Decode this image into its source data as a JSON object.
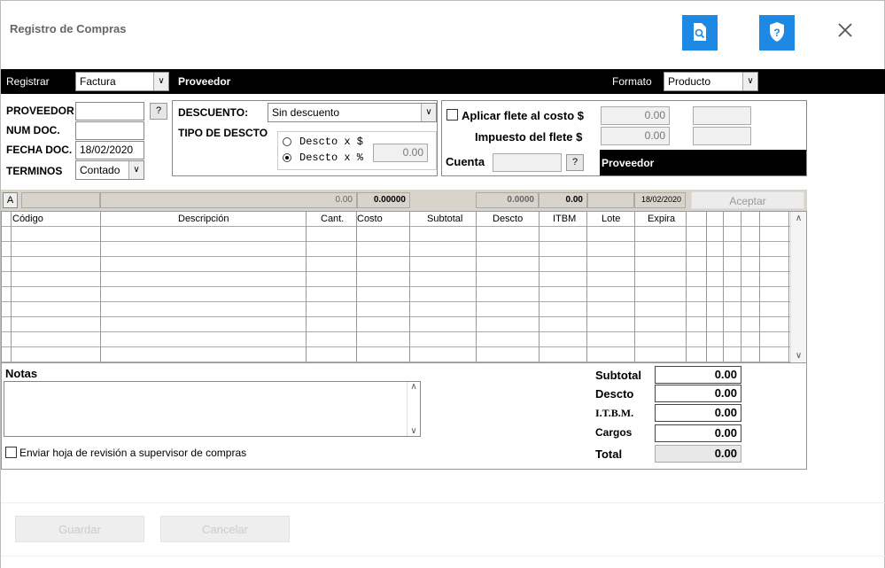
{
  "window": {
    "title": "Registro de Compras"
  },
  "icons": {
    "preview": "document-search-icon",
    "security": "shield-question-icon",
    "close": "close-icon"
  },
  "topbar": {
    "registrar_label": "Registrar",
    "registrar_value": "Factura",
    "proveedor_label": "Proveedor",
    "formato_label": "Formato",
    "formato_value": "Producto"
  },
  "form": {
    "proveedor_label": "PROVEEDOR",
    "proveedor_value": "",
    "numdoc_label": "NUM DOC.",
    "numdoc_value": "",
    "fecha_label": "FECHA  DOC.",
    "fecha_value": "18/02/2020",
    "terminos_label": "TERMINOS",
    "terminos_value": "Contado",
    "help": "?"
  },
  "descuento": {
    "label": "DESCUENTO:",
    "value": "Sin descuento",
    "tipo_label": "TIPO DE DESCTO",
    "opt1": "Descto x $",
    "opt2": "Descto x %",
    "amount": "0.00"
  },
  "flete": {
    "aplicar_label": "Aplicar flete al costo $",
    "aplicar_value": "0.00",
    "impuesto_label": "Impuesto del flete $",
    "impuesto_value": "0.00",
    "cuenta_label": "Cuenta",
    "cuenta_value": "",
    "proveedor_label": "Proveedor"
  },
  "toolstrip": {
    "a_label": "A",
    "cant": "0.00",
    "costo": "0.00000",
    "descto": "0.0000",
    "itbm": "0.00",
    "expira": "18/02/2020",
    "aceptar": "Aceptar"
  },
  "grid": {
    "columns": [
      "Código",
      "Descripción",
      "Cant.",
      "Costo",
      "Subtotal",
      "Descto",
      "ITBM",
      "Lote",
      "Expira"
    ],
    "row_count": 9
  },
  "notas": {
    "label": "Notas",
    "value": ""
  },
  "enviar_label": "Enviar hoja de revisión a supervisor de compras",
  "totals": {
    "subtotal_label": "Subtotal",
    "subtotal": "0.00",
    "descto_label": "Descto",
    "descto": "0.00",
    "itbm_label": "I.T.B.M.",
    "itbm": "0.00",
    "cargos_label": "Cargos",
    "cargos": "0.00",
    "total_label": "Total",
    "total": "0.00"
  },
  "actions": {
    "guardar": "Guardar",
    "cancelar": "Cancelar"
  }
}
